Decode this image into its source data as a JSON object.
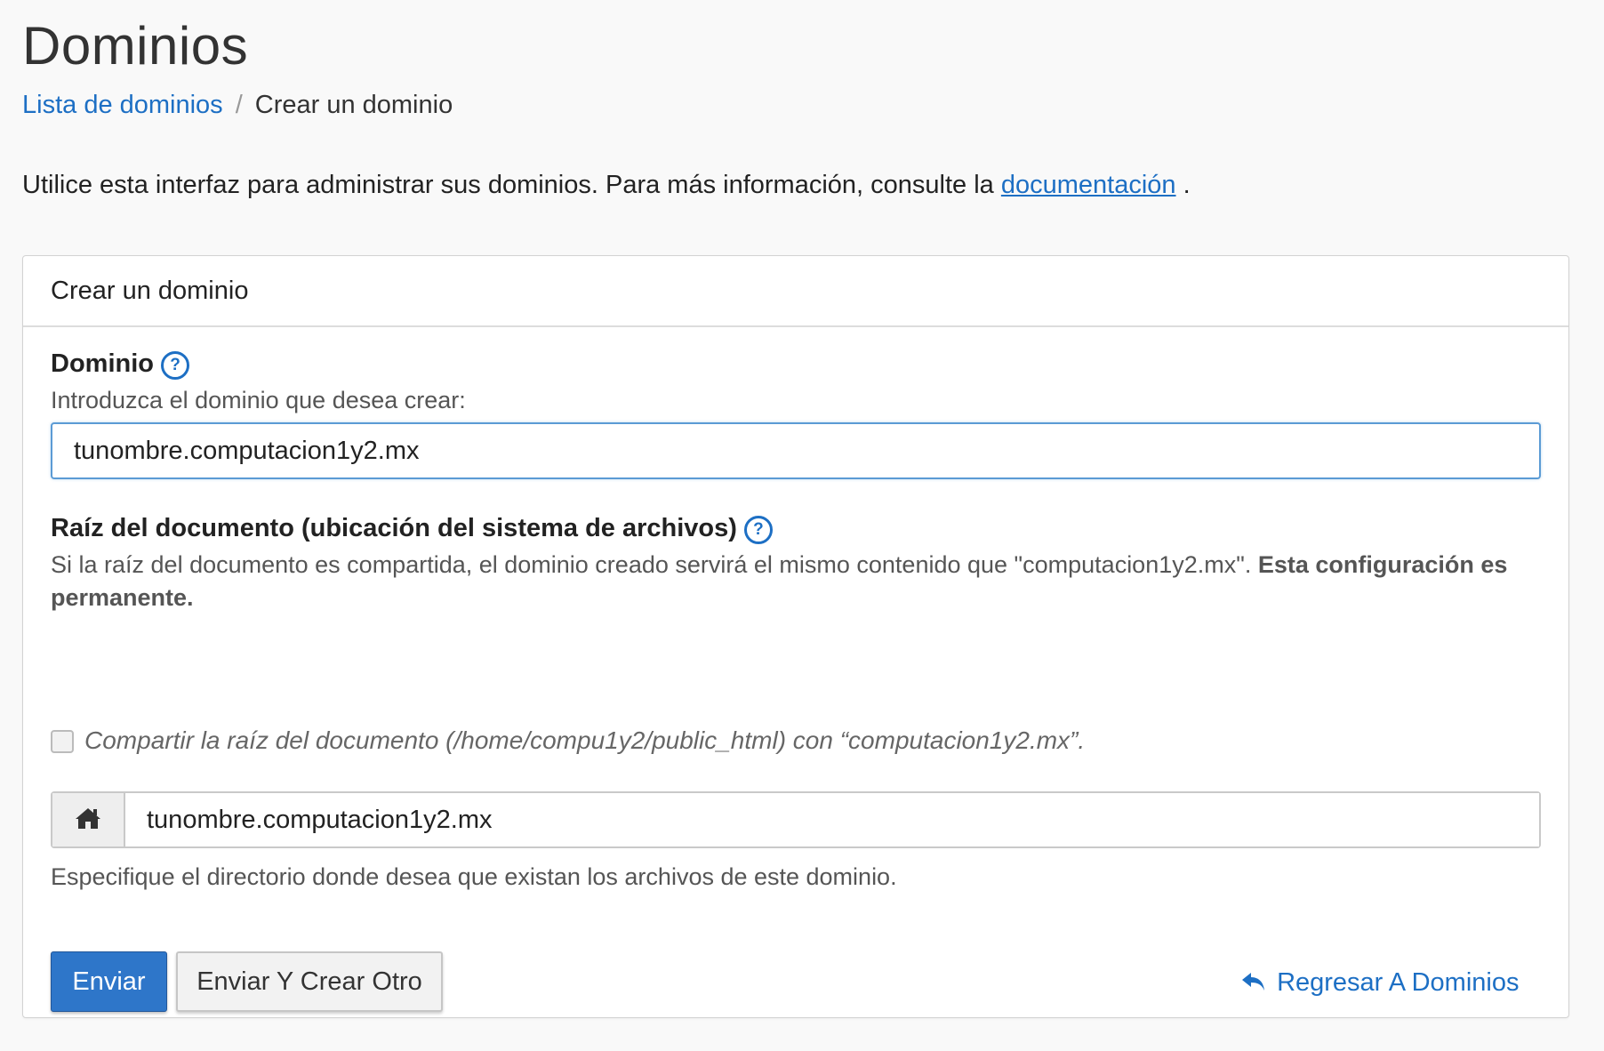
{
  "page": {
    "title": "Dominios",
    "breadcrumb": {
      "link_label": "Lista de dominios",
      "separator": "/",
      "current": "Crear un dominio"
    },
    "intro": {
      "text_before": "Utilice esta interfaz para administrar sus dominios. Para más información, consulte la ",
      "link_label": "documentación",
      "text_after": " ."
    }
  },
  "panel": {
    "heading": "Crear un dominio",
    "domain": {
      "label": "Dominio",
      "help_icon": "question-circle-icon",
      "description": "Introduzca el dominio que desea crear:",
      "value": "tunombre.computacion1y2.mx"
    },
    "docroot": {
      "label": "Raíz del documento (ubicación del sistema de archivos)",
      "help_icon": "question-circle-icon",
      "description_plain": "Si la raíz del documento es compartida, el dominio creado servirá el mismo contenido que \"computacion1y2.mx\". ",
      "description_bold": "Esta configuración es permanente.",
      "share_checkbox_label": "Compartir la raíz del documento (/home/compu1y2/public_html) con “computacion1y2.mx”.",
      "share_checked": false,
      "addon_icon": "home-icon",
      "value": "tunombre.computacion1y2.mx",
      "hint": "Especifique el directorio donde desea que existan los archivos de este dominio."
    },
    "actions": {
      "submit_label": "Enviar",
      "submit_another_label": "Enviar Y Crear Otro",
      "back_label": "Regresar A Dominios",
      "back_icon": "reply-arrow-icon"
    }
  },
  "colors": {
    "link": "#1d6fc4",
    "primary_button": "#2e76c9",
    "background": "#f9f9f9"
  }
}
